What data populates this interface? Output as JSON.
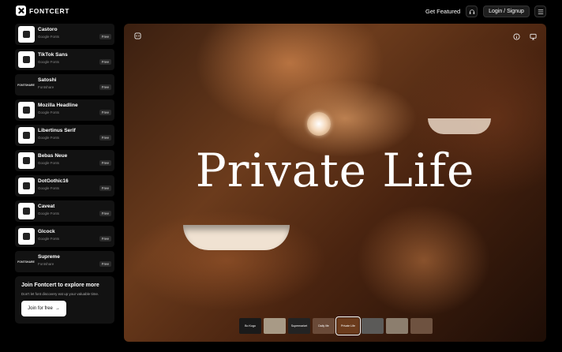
{
  "header": {
    "logo_text": "FONTCERT",
    "get_featured": "Get Featured",
    "login_label": "Login / Signup"
  },
  "sidebar": {
    "fonts": [
      {
        "name": "Castoro",
        "source": "Google Fonts",
        "badge": "Free"
      },
      {
        "name": "TikTok Sans",
        "source": "Google Fonts",
        "badge": "Free"
      },
      {
        "name": "Satoshi",
        "source": "Fontshare",
        "badge": "Free",
        "thumb_word": "FONTSHARE"
      },
      {
        "name": "Mozilla Headline",
        "source": "Google Fonts",
        "badge": "Free"
      },
      {
        "name": "Libertinus Serif",
        "source": "Google Fonts",
        "badge": "Free"
      },
      {
        "name": "Bebas Neue",
        "source": "Google Fonts",
        "badge": "Free"
      },
      {
        "name": "DotGothic16",
        "source": "Google Fonts",
        "badge": "Free"
      },
      {
        "name": "Caveat",
        "source": "Google Fonts",
        "badge": "Free"
      },
      {
        "name": "Glcock",
        "source": "Google Fonts",
        "badge": "Free"
      },
      {
        "name": "Supreme",
        "source": "Fontshare",
        "badge": "Free",
        "thumb_word": "FONTSHARE"
      }
    ],
    "join": {
      "title": "Join Fontcert to explore more",
      "desc": "Don't let font discovery eat up your valuable time.",
      "button": "Join for free"
    }
  },
  "hero": {
    "title": "Private Life",
    "thumbnails": [
      {
        "label": "Bo Kogo",
        "bg": "#1a1a1a"
      },
      {
        "label": "",
        "bg": "#a89a86"
      },
      {
        "label": "Supermarket",
        "bg": "#232323"
      },
      {
        "label": "Daily life",
        "bg": "#6a4a38"
      },
      {
        "label": "Private Life",
        "bg": "#6b3b1c",
        "active": true
      },
      {
        "label": "",
        "bg": "#5b5a58"
      },
      {
        "label": "",
        "bg": "#8c7e6e"
      },
      {
        "label": "",
        "bg": "#6e5240"
      }
    ]
  },
  "icons": {
    "menu": "hamburger-icon",
    "headset": "headset-icon",
    "info": "info-icon",
    "monitor": "monitor-icon",
    "code": "code-icon",
    "arrow": "arrow-right-icon"
  }
}
